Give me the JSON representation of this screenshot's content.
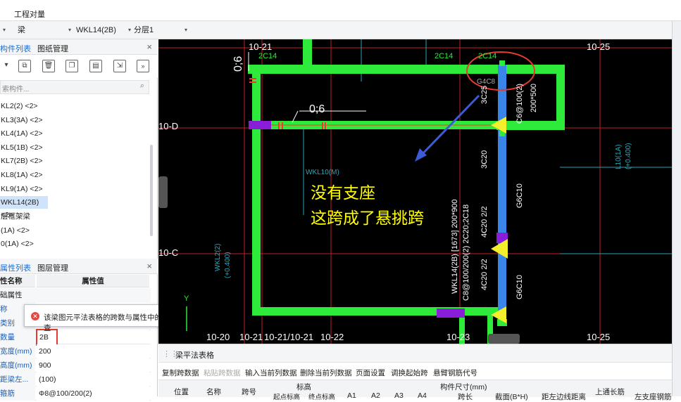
{
  "ribbon": {
    "tab": "工程对量"
  },
  "selector": {
    "category": "梁",
    "component": "WKL14(2B)",
    "layer": "分层1"
  },
  "component_panel": {
    "tabs": [
      "构件列表",
      "图纸管理"
    ],
    "search_placeholder": "索构件...",
    "items": [
      "KL2(2) <2>",
      "KL3(3A) <2>",
      "KL4(1A) <2>",
      "KL5(1B) <2>",
      "KL7(2B) <2>",
      "KL8(1A) <2>",
      "KL9(1A) <2>",
      "WKL14(2B) <2>",
      "层框架梁",
      "(1A) <2>",
      "0(1A) <2>"
    ],
    "selected_index": 7
  },
  "property_panel": {
    "tabs": [
      "属性列表",
      "图层管理"
    ],
    "col_name": "性名称",
    "col_value": "属性值",
    "rows": [
      {
        "name": "础属性",
        "value": ""
      },
      {
        "name": "称",
        "value": ""
      },
      {
        "name": "类别",
        "value": ""
      },
      {
        "name": "数量",
        "value": "2B"
      },
      {
        "name": "宽度(mm)",
        "value": "200"
      },
      {
        "name": "高度(mm)",
        "value": "900"
      },
      {
        "name": "距梁左...",
        "value": "(100)"
      },
      {
        "name": "箍筋",
        "value": "Φ8@100/200(2)"
      }
    ],
    "highlight_value": "2B"
  },
  "tooltip": {
    "message": "该梁图元平法表格的跨数与属性中的跨数信息不相同，请核查"
  },
  "canvas": {
    "axes": [
      "10-D",
      "10-C",
      "10-20",
      "10-21",
      "10-21/10-21",
      "10-22",
      "10-23",
      "10-25",
      "10-25",
      "10-21"
    ],
    "beam_labels": [
      "2C14",
      "2C14",
      "2C14",
      "0;6",
      "0;6",
      "WKL10(M)",
      "WKL2(2)",
      "(+0.400)",
      "L10(1A)",
      "(+0.400)",
      "3C25",
      "3C20",
      "C6@100(2)",
      "200*500",
      "G6C10",
      "G6C10",
      "WKL14(2B) [1673] 200*900",
      "C8@100/200(2) 2C20;2C18",
      "4C20 2/2",
      "4C20 2/2",
      "G4C8"
    ],
    "annotation_line1": "没有支座",
    "annotation_line2": "这跨成了悬挑跨",
    "colors": {
      "beam": "#2eea3a",
      "column": "#8a1ed8",
      "selected": "#3a86e8",
      "arrow": "#3d5bd6",
      "support": "#f3ef2a",
      "text": "#ffff00"
    }
  },
  "bottom_panel": {
    "title": "梁平法表格",
    "actions": [
      "复制跨数据",
      "粘贴跨数据",
      "输入当前列数据",
      "删除当前列数据",
      "页面设置",
      "调换起始跨",
      "悬臂钢筋代号"
    ],
    "disabled_actions": [
      1
    ],
    "headers": [
      "位置",
      "名称",
      "跨号",
      "标高",
      "起点标高",
      "终点标高",
      "A1",
      "A2",
      "A3",
      "A4",
      "构件尺寸(mm)",
      "跨长",
      "截面(B*H)",
      "距左边线距离",
      "上通长筋",
      "左支座钢筋"
    ]
  }
}
